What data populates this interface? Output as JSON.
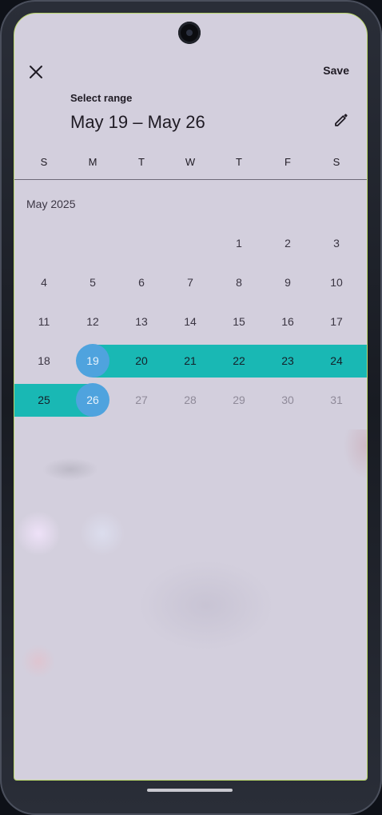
{
  "dialog": {
    "close_icon": "close-icon",
    "save_label": "Save",
    "headline_label": "Select range",
    "headline": "May 19 – May 26",
    "edit_icon": "pencil-icon"
  },
  "weekdays": [
    "S",
    "M",
    "T",
    "W",
    "T",
    "F",
    "S"
  ],
  "month_label": "May 2025",
  "days": [
    "1",
    "2",
    "3",
    "4",
    "5",
    "6",
    "7",
    "8",
    "9",
    "10",
    "11",
    "12",
    "13",
    "14",
    "15",
    "16",
    "17",
    "18",
    "19",
    "20",
    "21",
    "22",
    "23",
    "24",
    "25",
    "26",
    "27",
    "28",
    "29",
    "30",
    "31"
  ],
  "selection": {
    "start": "19",
    "end": "26"
  },
  "colors": {
    "range": "#19b8b4",
    "endpoint": "#4fa3de",
    "surface": "#d3cfdd"
  }
}
